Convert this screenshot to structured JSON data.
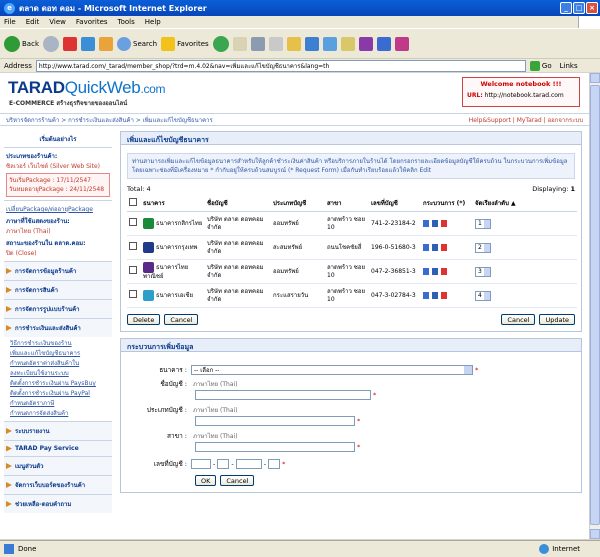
{
  "window": {
    "title": "ตลาด ดอท คอม - Microsoft Internet Explorer"
  },
  "menu": [
    "File",
    "Edit",
    "View",
    "Favorites",
    "Tools",
    "Help"
  ],
  "toolbar": {
    "back": "Back",
    "search": "Search",
    "favorites": "Favorites"
  },
  "address": {
    "label": "Address",
    "url": "http://www.tarad.com/_tarad/member_shop/?trd=m.4.02&nav=เพิ่มและแก้ไขบัญชีธนาคาร&lang=th",
    "go": "Go",
    "links": "Links"
  },
  "site": {
    "logo_a": "TARAD",
    "logo_b": "QuickWeb",
    "logo_c": ".com",
    "tagline": "E-COMMERCE สร้างธุรกิจขายของออนไลน์",
    "welcome": "Welcome notebook !!!",
    "url_label": "URL:",
    "url_value": "http://notebook.tarad.com"
  },
  "breadcrumb": "บริหารจัดการร้านค้า > การชำระเงินและส่งสินค้า > เพิ่มและแก้ไขบัญชีธนาคาร",
  "top_links": {
    "help": "Help&Support",
    "mytarad": "MyTarad",
    "logout": "ออกจากระบบ"
  },
  "sidebar": {
    "how_to": "เริ่มต้นอย่างไร",
    "package_label": "ประเภทของร้านค้า:",
    "package_value": "ซิลเวอร์ เว็บไซต์ (Silver Web Site)",
    "start_date": "วันเริ่มPackage : 17/11/2547",
    "end_date": "วันหมดอายุPackage : 24/11/2548",
    "change_package": "เปลี่ยนPackage/ต่ออายุPackage",
    "language_label": "ภาษาที่ใช้แสดงของร้าน:",
    "language_value": "ภาษาไทย (Thai)",
    "status_label": "สถานะของร้านใน ตลาด.คอม:",
    "status_value": "ปิด (Close)",
    "menus": [
      "การจัดการข้อมูลร้านค้า",
      "การจัดการสินค้า",
      "การจัดการรูปแบบร้านค้า",
      "การชำระเงินและส่งสินค้า"
    ],
    "submenu": [
      "วิธีการชำระเงินของร้าน",
      "เพิ่มและแก้ไขบัญชีธนาคาร",
      "กำหนดอัตราค่าส่งสินค้าใน",
      "ลงทะเบียนใช้งานระบบ",
      "ติดตั้งการชำระเงินผ่าน PaysBuy",
      "ติดตั้งการชำระเงินผ่าน PayPal",
      "กำหนดอัตราภาษี",
      "กำหนดการจัดส่งสินค้า"
    ],
    "menus2": [
      "ระบบรายงาน",
      "TARAD Pay Service",
      "เมนูส่วนตัว",
      "จัดการเว็บบอร์ดของร้านค้า",
      "ช่วยเหลือ-ตอบคำถาม"
    ]
  },
  "main": {
    "title": "เพิ่มและแก้ไขบัญชีธนาคาร",
    "note": "ท่านสามารถเพิ่มและแก้ไขข้อมูลธนาคารสำหรับให้ลูกค้าชำระเงินค่าสินค้า หรือบริการภายในร้านได้ โดยกรอกรายละเอียดข้อมูลบัญชีให้ครบถ้วน ในกระบวนการเพิ่มข้อมูล โดยเฉพาะช่องที่มีเครื่องหมาย * กำกับอยู่ให้ครบถ้วนสมบูรณ์ (* Request Form) เมื่อกันทำเรียบร้อยแล้วให้คลิก Edit",
    "total_label": "Total:",
    "total_value": "4",
    "displaying_label": "Displaying:",
    "displaying_value": "1",
    "columns": [
      "ธนาคาร",
      "ชื่อบัญชี",
      "ประเภทบัญชี",
      "สาขา",
      "เลขที่บัญชี",
      "กระบวนการ (*)",
      "จัดเรียงลำดับ ▲"
    ],
    "rows": [
      {
        "bank": "ธนาคารกสิกรไทย",
        "name": "บริษัท ตลาด ดอทคอม จำกัด",
        "type": "ออมทรัพย์",
        "branch": "ลาดพร้าว ซอย 10",
        "account": "741-2-23184-2",
        "order": "1",
        "color": "#1a8a3a"
      },
      {
        "bank": "ธนาคารกรุงเทพ",
        "name": "บริษัท ตลาด ดอทคอม จำกัด",
        "type": "สะสมทรัพย์",
        "branch": "ถนนโชคชัยสี่",
        "account": "196-0-51680-3",
        "order": "2",
        "color": "#1f3a8a"
      },
      {
        "bank": "ธนาคารไทยพาณิชย์",
        "name": "บริษัท ตลาด ดอทคอม จำกัด",
        "type": "ออมทรัพย์",
        "branch": "ลาดพร้าว ซอย 10",
        "account": "047-2-36851-3",
        "order": "3",
        "color": "#5a2a8a"
      },
      {
        "bank": "ธนาคารเอเชีย",
        "name": "บริษัท ตลาด ดอทคอม จำกัด",
        "type": "กระแสรายวัน",
        "branch": "ลาดพร้าว ซอย 10",
        "account": "047-3-02784-3",
        "order": "4",
        "color": "#2aa0c8"
      }
    ],
    "buttons": {
      "delete": "Delete",
      "cancel": "Cancel",
      "cancel2": "Cancel",
      "update": "Update"
    }
  },
  "add_form": {
    "title": "กระบวนการเพิ่มข้อมูล",
    "bank_label": "ธนาคาร :",
    "bank_value": "-- เลือก --",
    "name_label": "ชื่อบัญชี :",
    "branch_label": "ประเภทบัญชี :",
    "branch2_label": "สาขา :",
    "account_label": "เลขที่บัญชี :",
    "lang_hint": "ภาษาไทย (Thai)",
    "ok": "OK",
    "cancel": "Cancel"
  },
  "status": {
    "text": "Done",
    "zone": "Internet"
  }
}
